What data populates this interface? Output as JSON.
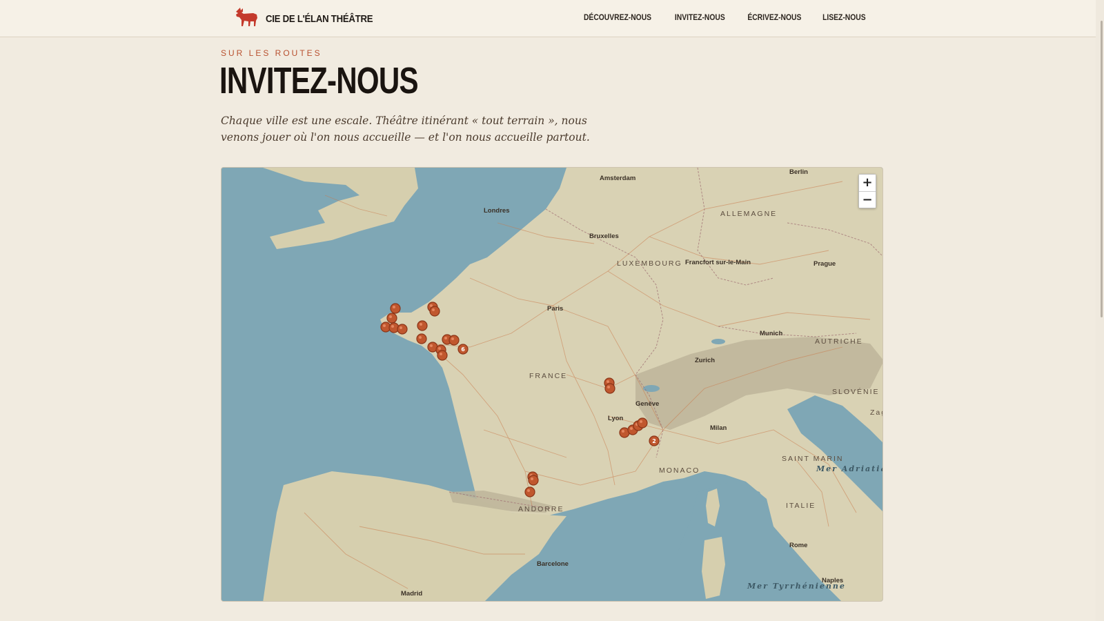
{
  "header": {
    "brand_name": "CIE DE L'ÉLAN THÉÂTRE",
    "nav": [
      "DÉCOUVREZ-NOUS",
      "INVITEZ-NOUS",
      "ÉCRIVEZ-NOUS",
      "LISEZ-NOUS"
    ]
  },
  "hero": {
    "eyebrow": "SUR LES ROUTES",
    "title": "INVITEZ-NOUS",
    "intro": "Chaque ville est une escale. Théâtre itinérant « tout terrain », nous venons jouer où l'on nous accueille — et l'on nous accueille partout."
  },
  "map": {
    "zoom_in": "+",
    "zoom_out": "−",
    "cities": [
      "Amsterdam",
      "Berlin",
      "Londres",
      "Bruxelles",
      "Francfort sur-le-Main",
      "Prague",
      "Paris",
      "Munich",
      "Zurich",
      "Genève",
      "Lyon",
      "Milan",
      "Rome",
      "Naples",
      "Barcelone",
      "Madrid"
    ],
    "countries": [
      "ALLEMAGNE",
      "LUXEMBOURG",
      "AUTRICHE",
      "FRANCE",
      "SLOVÉNIE",
      "SAINT MARIN",
      "MONACO",
      "ITALIE",
      "ANDORRE",
      "Zagr"
    ],
    "seas": [
      "Mer Adriatique",
      "Mer Tyrrhénienne"
    ],
    "cluster_counts": [
      "6",
      "2"
    ],
    "colors": {
      "marker": "#c0572e",
      "sea": "#7fa7b5",
      "land": "#d9d2b4",
      "accent": "#b8502f"
    }
  }
}
